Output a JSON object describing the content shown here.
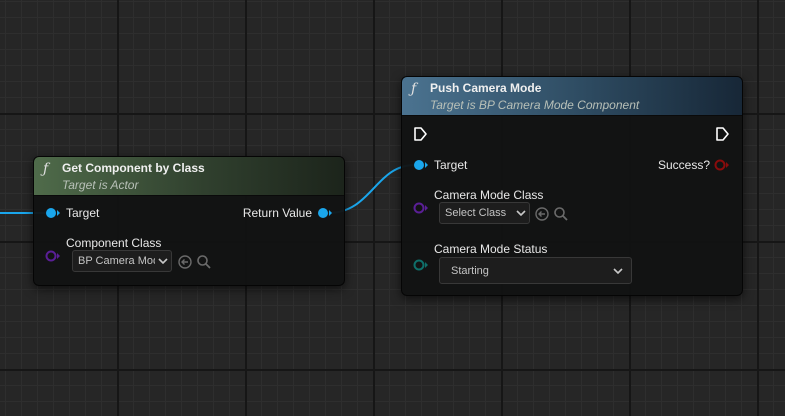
{
  "nodes": {
    "get_component": {
      "title": "Get Component by Class",
      "subtitle": "Target is Actor",
      "fn_icon": "function-icon",
      "header_color": "#4f6b4a",
      "pins": {
        "target": "Target",
        "return_value": "Return Value",
        "component_class": "Component Class",
        "component_class_value": "BP Camera Mode"
      }
    },
    "push_camera": {
      "title": "Push Camera Mode",
      "subtitle": "Target is BP Camera Mode Component",
      "fn_icon": "function-icon",
      "header_color": "#4b7390",
      "pins": {
        "target": "Target",
        "success": "Success?",
        "camera_mode_class": "Camera Mode Class",
        "camera_mode_class_value": "Select Class",
        "camera_mode_status": "Camera Mode Status",
        "camera_mode_status_value": "Starting"
      }
    }
  },
  "colors": {
    "object_pin": "#1aa6ec",
    "class_pin": "#5a1f96",
    "enum_pin": "#0f6f6a",
    "bool_pin": "#8a0c0c",
    "exec_pin": "#ffffff"
  }
}
